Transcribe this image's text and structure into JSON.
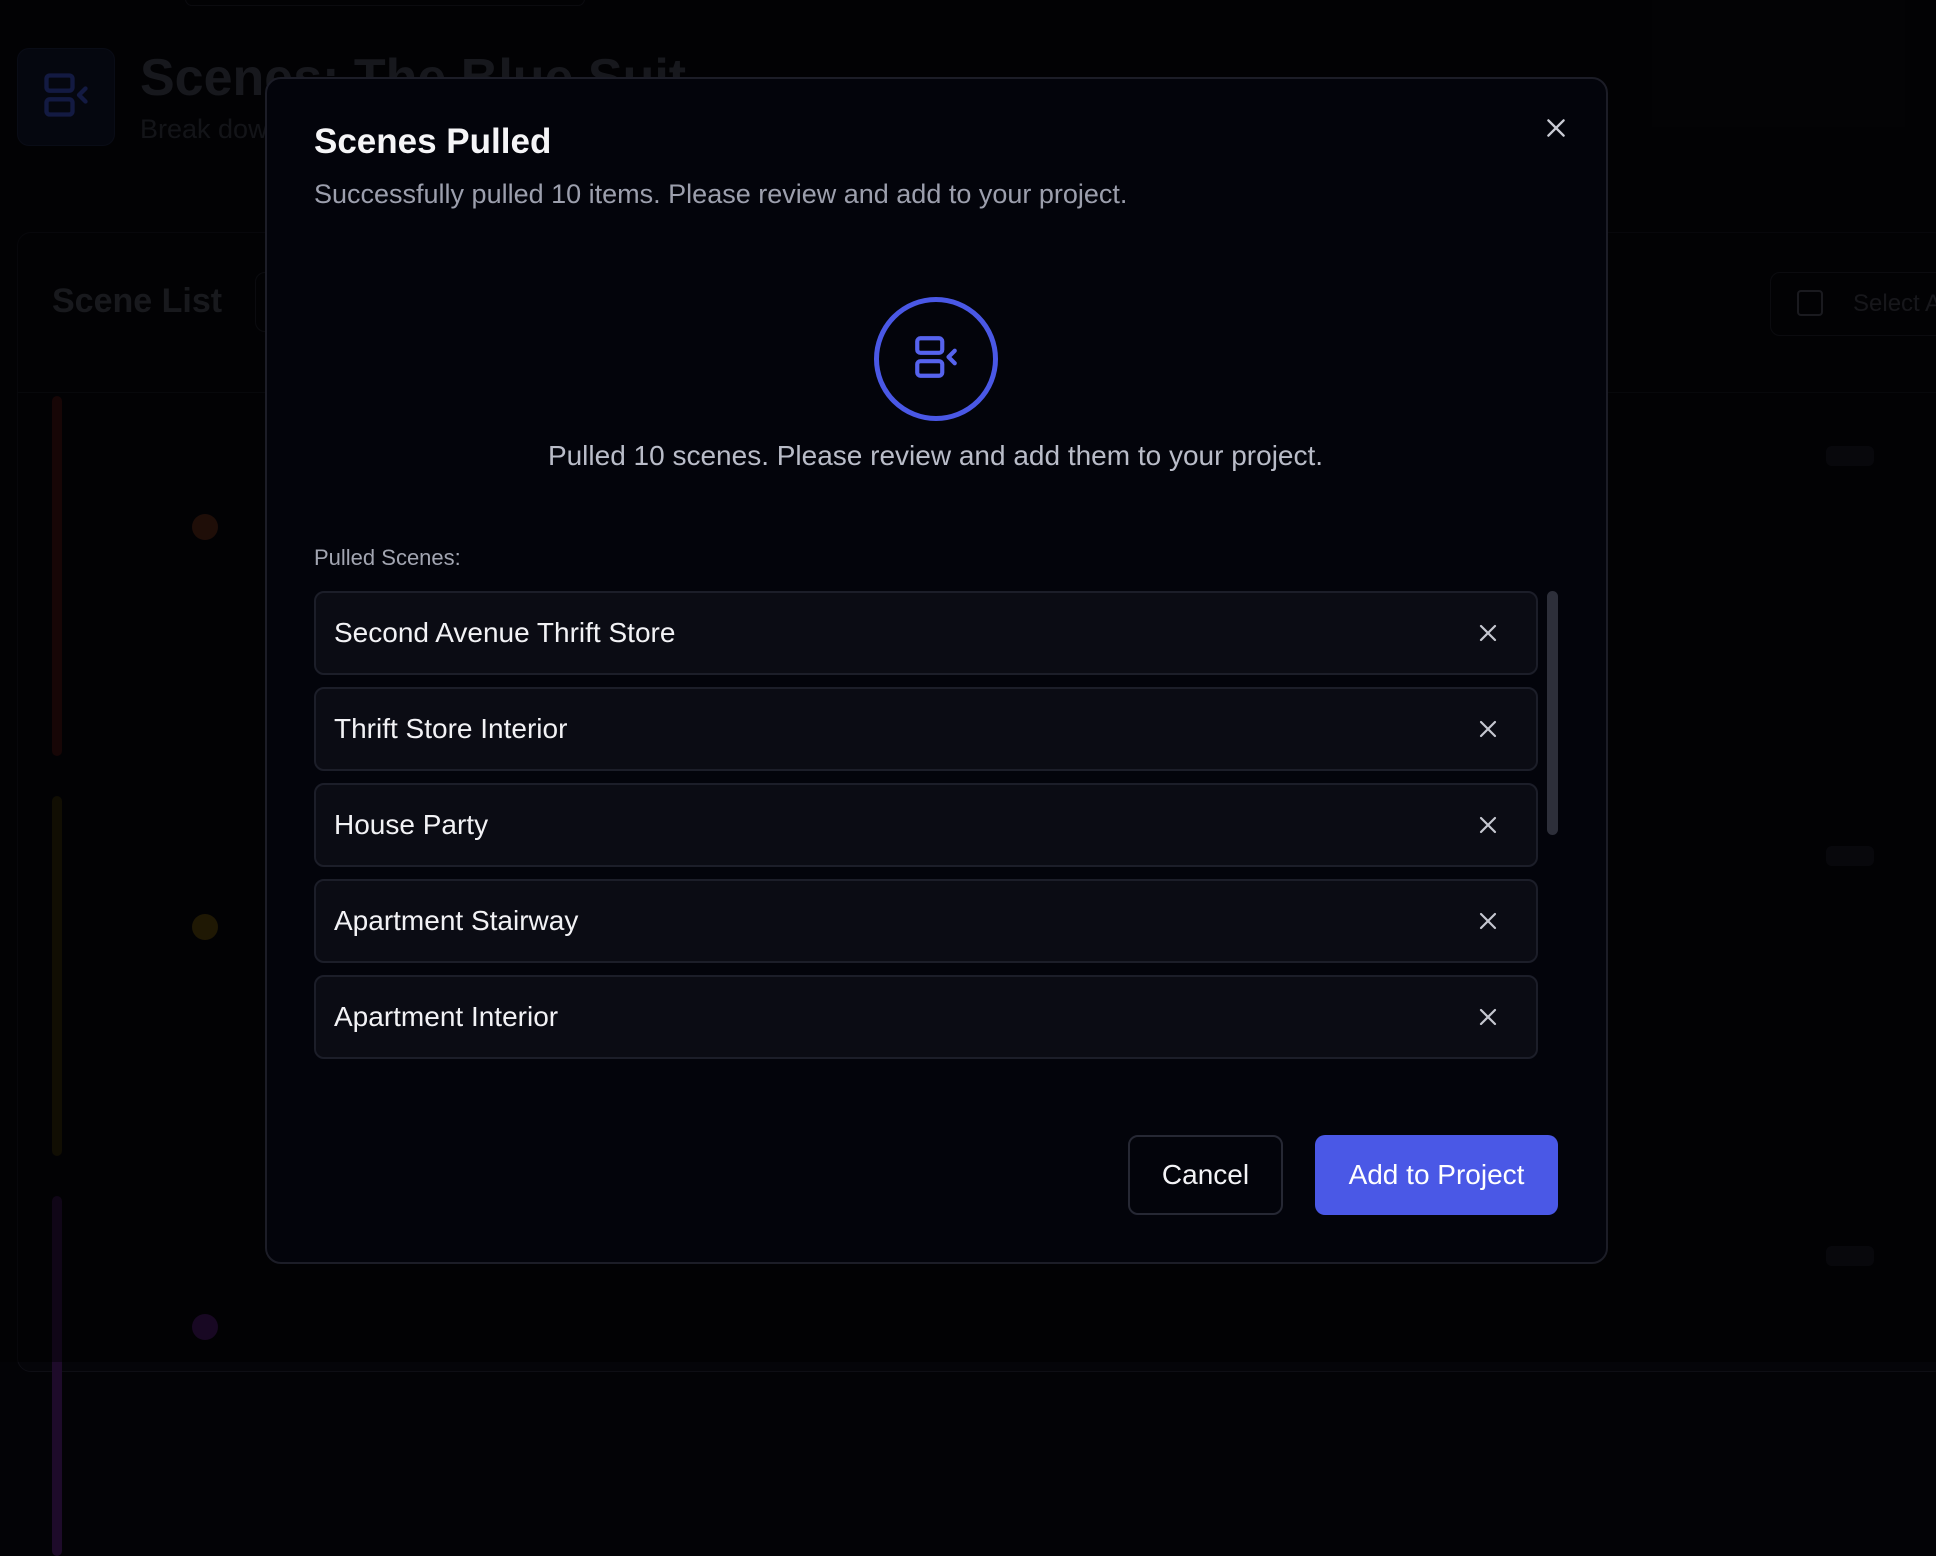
{
  "background": {
    "page_title": "Scenes: The Blue Suit",
    "page_subtitle": "Break down your script into scenes",
    "list_title": "Scene List",
    "select_all_label": "Select All",
    "page_icon": "scene-split-icon",
    "card_stripe_colors": [
      "#ef4444",
      "#eab308",
      "#a855f7"
    ]
  },
  "modal": {
    "title": "Scenes Pulled",
    "description": "Successfully pulled 10 items. Please review and add to your project.",
    "hero_icon": "scene-split-icon",
    "hero_text": "Pulled 10 scenes. Please review and add them to your project.",
    "list_label": "Pulled Scenes:",
    "scenes": [
      {
        "name": "Second Avenue Thrift Store"
      },
      {
        "name": "Thrift Store Interior"
      },
      {
        "name": "House Party"
      },
      {
        "name": "Apartment Stairway"
      },
      {
        "name": "Apartment Interior"
      }
    ],
    "cancel_label": "Cancel",
    "add_label": "Add to Project",
    "close_icon": "close-icon",
    "accent_color": "#4a58e6"
  }
}
